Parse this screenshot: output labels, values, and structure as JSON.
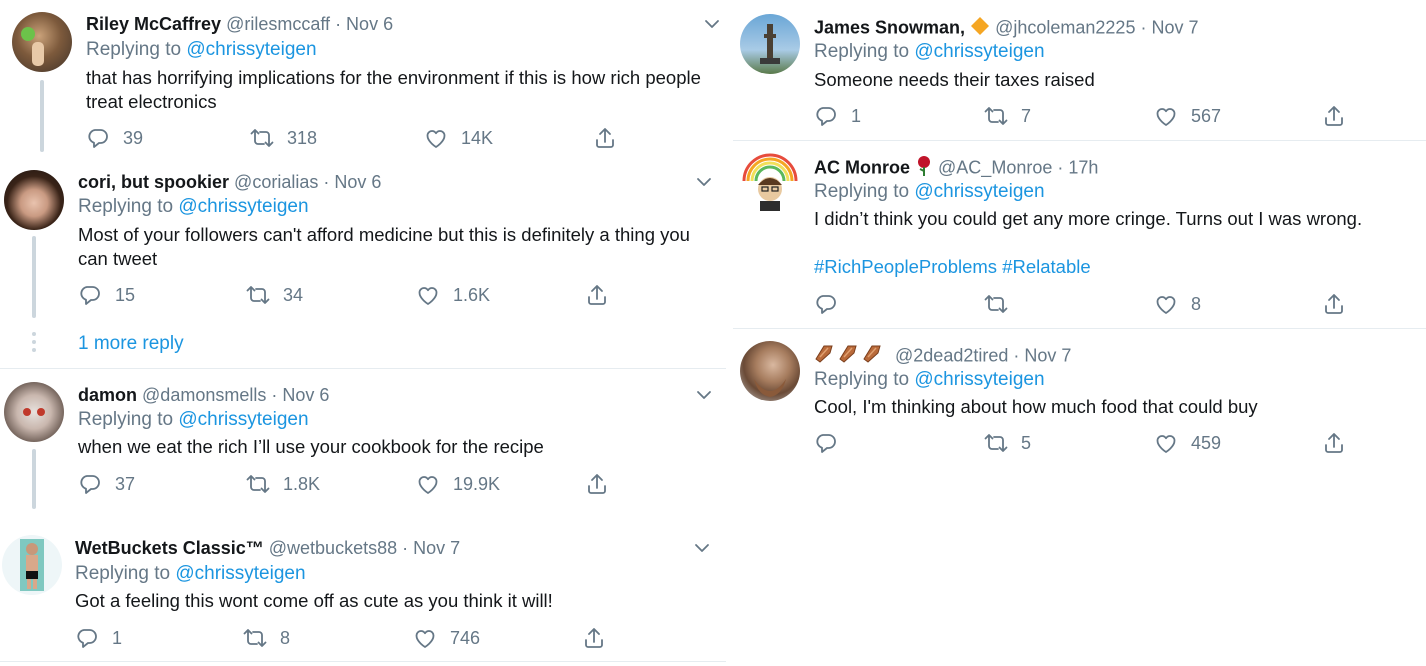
{
  "left": {
    "tweets": [
      {
        "name": "Riley McCaffrey",
        "handle": "@rilesmccaff",
        "date": "· Nov 6",
        "replying": "Replying to",
        "mention": "@chrissyteigen",
        "text": "that has horrifying implications for the environment if this is how rich people treat electronics",
        "replies": "39",
        "retweets": "318",
        "likes": "14K"
      },
      {
        "name": "cori, but spookier",
        "handle": "@corialias",
        "date": "· Nov 6",
        "replying": "Replying to",
        "mention": "@chrissyteigen",
        "text": "Most of your followers can't afford medicine but this is definitely a thing you can tweet",
        "replies": "15",
        "retweets": "34",
        "likes": "1.6K"
      },
      {
        "name": "damon",
        "handle": "@damonsmells",
        "date": "· Nov 6",
        "replying": "Replying to",
        "mention": "@chrissyteigen",
        "text": "when we eat the rich I’ll use your cookbook for the recipe",
        "replies": "37",
        "retweets": "1.8K",
        "likes": "19.9K"
      },
      {
        "name": "WetBuckets Classic™",
        "handle": "@wetbuckets88",
        "date": "· Nov 7",
        "replying": "Replying to",
        "mention": "@chrissyteigen",
        "text": "Got a feeling this wont come off as cute as you think it will!",
        "replies": "1",
        "retweets": "8",
        "likes": "746"
      }
    ],
    "more_reply": "1 more reply"
  },
  "right": {
    "tweets": [
      {
        "name": "James Snowman,",
        "handle": "@jhcoleman2225",
        "date": "· Nov 7",
        "replying": "Replying to",
        "mention": "@chrissyteigen",
        "text": "Someone needs their taxes raised",
        "replies": "1",
        "retweets": "7",
        "likes": "567"
      },
      {
        "name": "AC Monroe",
        "handle": "@AC_Monroe",
        "date": "· 17h",
        "replying": "Replying to",
        "mention": "@chrissyteigen",
        "text": "I didn’t think you could get any more cringe. Turns out I was wrong.",
        "hashtags": "#RichPeopleProblems #Relatable",
        "replies": "",
        "retweets": "",
        "likes": "8"
      },
      {
        "name": "",
        "handle": "@2dead2tired",
        "date": "· Nov 7",
        "replying": "Replying to",
        "mention": "@chrissyteigen",
        "text": "Cool, I'm thinking about how much food that could buy",
        "replies": "",
        "retweets": "5",
        "likes": "459"
      }
    ]
  },
  "icons": {
    "reply": "reply-icon",
    "retweet": "retweet-icon",
    "like": "heart-icon",
    "share": "share-icon",
    "more": "chevron-down-icon"
  },
  "colors": {
    "link": "#1b95e0",
    "meta": "#657786",
    "icon": "#657786",
    "divider": "#e6ecf0",
    "thread": "#ccd6dd"
  }
}
